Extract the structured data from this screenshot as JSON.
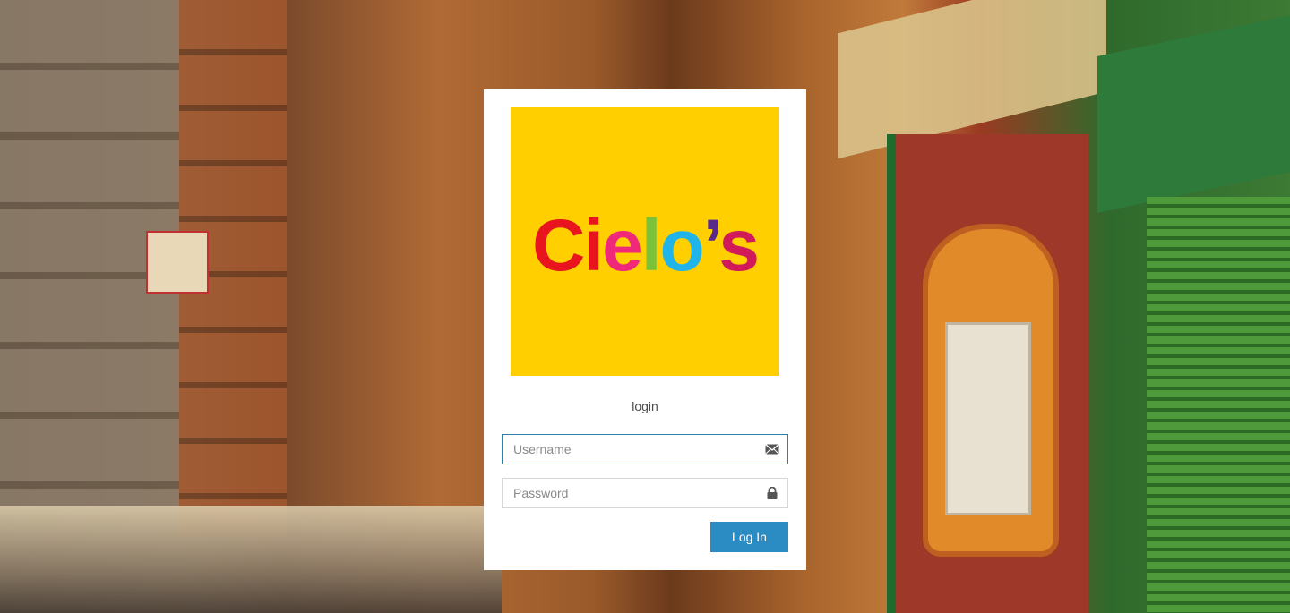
{
  "brand": {
    "name": "Cielo's",
    "logo_background": "#ffcf00"
  },
  "login": {
    "title": "login",
    "username": {
      "placeholder": "Username",
      "value": "",
      "icon": "envelope-icon"
    },
    "password": {
      "placeholder": "Password",
      "value": "",
      "icon": "lock-icon"
    },
    "submit_label": "Log In"
  },
  "colors": {
    "accent": "#2b8cc4",
    "focus_border": "#2b7fa8"
  }
}
